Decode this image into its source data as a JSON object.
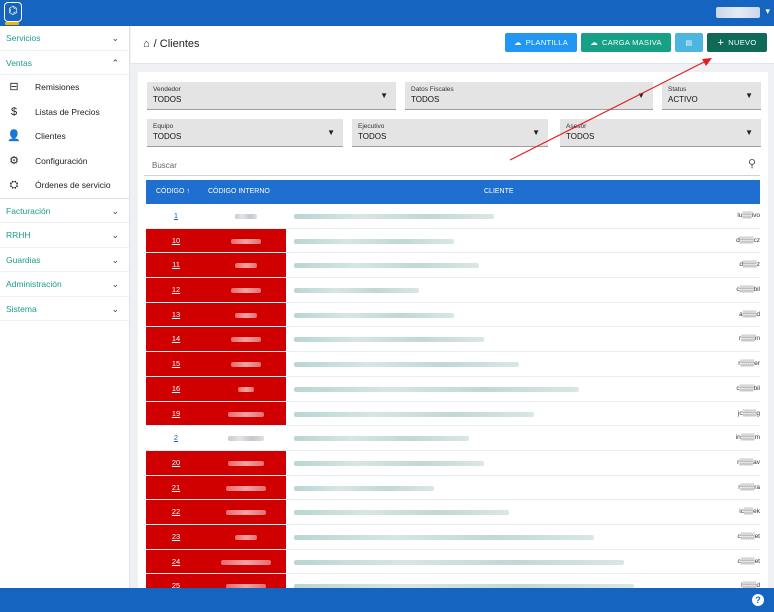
{
  "sidebar": {
    "sections": [
      {
        "label": "Servicios",
        "chev": "⌄"
      },
      {
        "label": "Ventas",
        "chev": "⌃"
      }
    ],
    "items": [
      {
        "label": "Remisiones",
        "icon": "⊟"
      },
      {
        "label": "Listas de Precios",
        "icon": "$"
      },
      {
        "label": "Clientes",
        "icon": "👤"
      },
      {
        "label": "Configuración",
        "icon": "⚙"
      },
      {
        "label": "Órdenes de servicio",
        "icon": "⛭"
      }
    ],
    "sections_after": [
      {
        "label": "Facturación",
        "chev": "⌄"
      },
      {
        "label": "RRHH",
        "chev": "⌄"
      },
      {
        "label": "Guardias",
        "chev": "⌄"
      },
      {
        "label": "Administración",
        "chev": "⌄"
      },
      {
        "label": "Sistema",
        "chev": "⌄"
      }
    ]
  },
  "header": {
    "title": "/ Clientes",
    "buttons": {
      "plantilla": "PLANTILLA",
      "carga": "CARGA MASIVA",
      "nuevo": "NUEVO"
    }
  },
  "filters": {
    "vendedor": {
      "label": "Vendedor",
      "value": "TODOS"
    },
    "fiscales": {
      "label": "Datos Fiscales",
      "value": "TODOS"
    },
    "status": {
      "label": "Status",
      "value": "ACTIVO"
    },
    "equipo": {
      "label": "Equipo",
      "value": "TODOS"
    },
    "ejecutivo": {
      "label": "Ejecutivo",
      "value": "TODOS"
    },
    "asesor": {
      "label": "Asesor",
      "value": "TODOS"
    }
  },
  "search": {
    "placeholder": "Buscar"
  },
  "table": {
    "col_code": "CÓDIGO ↑",
    "col_int": "CÓDIGO INTERNO",
    "col_cli": "CLIENTE",
    "rows": [
      {
        "code": "1",
        "red": false,
        "tail": "lu▒▒ivo",
        "cw": 200,
        "iw": 22
      },
      {
        "code": "10",
        "red": true,
        "tail": "d▒▒▒cz",
        "cw": 160,
        "iw": 30
      },
      {
        "code": "11",
        "red": true,
        "tail": "d▒▒▒z",
        "cw": 185,
        "iw": 22
      },
      {
        "code": "12",
        "red": true,
        "tail": "c▒▒▒bil",
        "cw": 125,
        "iw": 30
      },
      {
        "code": "13",
        "red": true,
        "tail": "a▒▒▒d",
        "cw": 160,
        "iw": 22
      },
      {
        "code": "14",
        "red": true,
        "tail": "r▒▒▒in",
        "cw": 190,
        "iw": 30
      },
      {
        "code": "15",
        "red": true,
        "tail": "r▒▒▒er",
        "cw": 225,
        "iw": 30
      },
      {
        "code": "16",
        "red": true,
        "tail": "c▒▒▒bil",
        "cw": 285,
        "iw": 16
      },
      {
        "code": "19",
        "red": true,
        "tail": "jc▒▒▒g",
        "cw": 240,
        "iw": 36
      },
      {
        "code": "2",
        "red": false,
        "tail": "in▒▒▒m",
        "cw": 175,
        "iw": 36
      },
      {
        "code": "20",
        "red": true,
        "tail": "r▒▒▒av",
        "cw": 190,
        "iw": 36
      },
      {
        "code": "21",
        "red": true,
        "tail": "r▒▒▒ra",
        "cw": 140,
        "iw": 40
      },
      {
        "code": "22",
        "red": true,
        "tail": "ic▒▒ek",
        "cw": 215,
        "iw": 40
      },
      {
        "code": "23",
        "red": true,
        "tail": "c▒▒▒et",
        "cw": 300,
        "iw": 22
      },
      {
        "code": "24",
        "red": true,
        "tail": "c▒▒▒et",
        "cw": 330,
        "iw": 50
      },
      {
        "code": "25",
        "red": true,
        "tail": "l▒▒▒d",
        "cw": 340,
        "iw": 40
      }
    ]
  },
  "colors": {
    "blue": "#1565c0",
    "teal": "#16a085",
    "red": "#d00000"
  }
}
